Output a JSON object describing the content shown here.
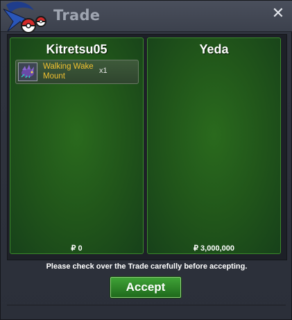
{
  "window": {
    "title": "Trade",
    "close_symbol": "✕"
  },
  "players": [
    {
      "name": "Kitretsu05",
      "items": [
        {
          "name": "Walking Wake Mount",
          "quantity": "x1",
          "icon": "mount-icon"
        }
      ],
      "money": "₽ 0"
    },
    {
      "name": "Yeda",
      "items": [],
      "money": "₽ 3,000,000"
    }
  ],
  "notice": "Please check over the Trade carefully before accepting.",
  "accept_label": "Accept",
  "colors": {
    "panel_green": "#20541a",
    "panel_border": "#3b8a2b",
    "item_name": "#f0c030",
    "button_green": "#3fa236"
  }
}
